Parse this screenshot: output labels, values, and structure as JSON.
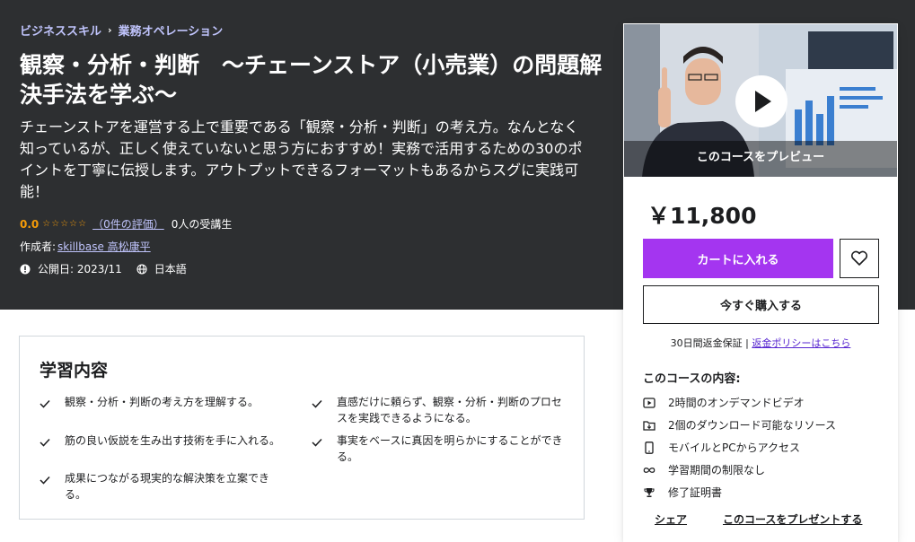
{
  "breadcrumb": {
    "items": [
      "ビジネススキル",
      "業務オペレーション"
    ],
    "separator": "›"
  },
  "course": {
    "title": "観察・分析・判断　～チェーンストア（小売業）の問題解決手法を学ぶ～",
    "description": "チェーンストアを運営する上で重要である「観察・分析・判断」の考え方。なんとなく知っているが、正しく使えていないと思う方におすすめ！実務で活用するための30のポイントを丁寧に伝授します。アウトプットできるフォーマットもあるからスグに実践可能！",
    "rating": "0.0",
    "stars": "☆☆☆☆☆",
    "rating_count": "（0件の評価）",
    "students": "0人の受講生",
    "creator_label": "作成者:",
    "creator": "skillbase 高松康平",
    "published": "公開日: 2023/11",
    "language": "日本語"
  },
  "sidebar": {
    "preview_label": "このコースをプレビュー",
    "price": "￥11,800",
    "cart_button": "カートに入れる",
    "buy_button": "今すぐ購入する",
    "guarantee_text": "30日間返金保証 | ",
    "guarantee_link": "返金ポリシーはこちら",
    "includes_title": "このコースの内容:",
    "includes": [
      {
        "icon": "video-icon",
        "label": "2時間のオンデマンドビデオ"
      },
      {
        "icon": "download-icon",
        "label": "2個のダウンロード可能なリソース"
      },
      {
        "icon": "mobile-icon",
        "label": "モバイルとPCからアクセス"
      },
      {
        "icon": "infinity-icon",
        "label": "学習期間の制限なし"
      },
      {
        "icon": "trophy-icon",
        "label": "修了証明書"
      }
    ],
    "share": "シェア",
    "gift": "このコースをプレゼントする"
  },
  "learn": {
    "title": "学習内容",
    "items": [
      "観察・分析・判断の考え方を理解する。",
      "直感だけに頼らず、観察・分析・判断のプロセスを実践できるようになる。",
      "筋の良い仮説を生み出す技術を手に入れる。",
      "事実をベースに真因を明らかにすることができる。",
      "成果につながる現実的な解決策を立案できる。"
    ]
  },
  "colors": {
    "hero_bg": "#2d2f31",
    "accent": "#a435f0",
    "link": "#c0c4fc",
    "star": "#f69c08"
  }
}
